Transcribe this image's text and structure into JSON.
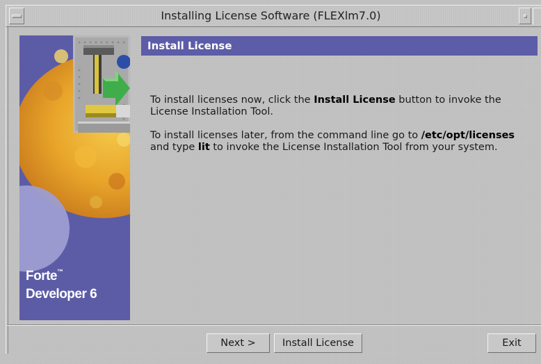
{
  "window": {
    "title": "Installing License Software (FLEXlm7.0)"
  },
  "banner": {
    "brand_line1": "Forte",
    "brand_tm": "™",
    "brand_line2": "Developer 6"
  },
  "main": {
    "header": "Install License",
    "p1_part1": "To install licenses now, click the ",
    "p1_bold": "Install License",
    "p1_part2": " button to invoke the License Installation Tool.",
    "p2_part1": "To install licenses later, from the command line go to ",
    "p2_bold_path": "/etc/opt/licenses",
    "p2_part2": " and type ",
    "p2_bold_cmd": "lit",
    "p2_part3": " to invoke the License Installation Tool from your system."
  },
  "buttons": {
    "next": "Next >",
    "install_license": "Install License",
    "exit": "Exit"
  },
  "colors": {
    "accent": "#5c5ca8",
    "window_bg": "#c3c3c3"
  }
}
